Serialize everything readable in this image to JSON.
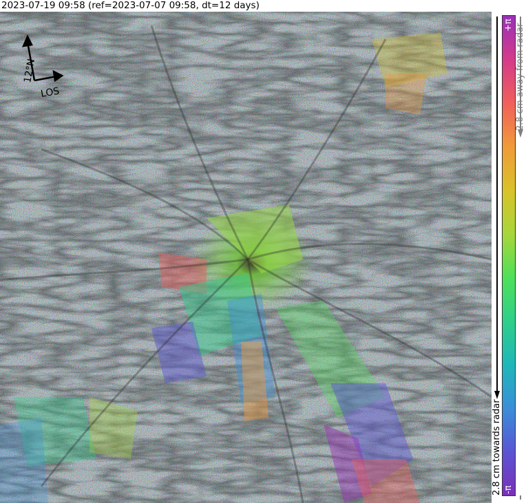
{
  "caption": "2023-07-19 09:58 (ref=2023-07-07 09:58, dt=12 days)",
  "compass": {
    "north_label": "12°N",
    "los_label": "LOS"
  },
  "colorbar": {
    "top_label": "+π",
    "bottom_label": "-π",
    "away_label": "2.8 cm away from radar",
    "towards_label": "2.8 cm towards radar",
    "stops": [
      "#7b2fb8",
      "#5a55d4",
      "#3a8fd9",
      "#1fb7b8",
      "#2fcf8a",
      "#4fe05a",
      "#a8d63a",
      "#d9c22a",
      "#f09a3a",
      "#f0605a",
      "#d43a8a",
      "#9a30b8"
    ]
  },
  "colors": {
    "away_arrow": "#808080",
    "towards_arrow": "#000000"
  }
}
